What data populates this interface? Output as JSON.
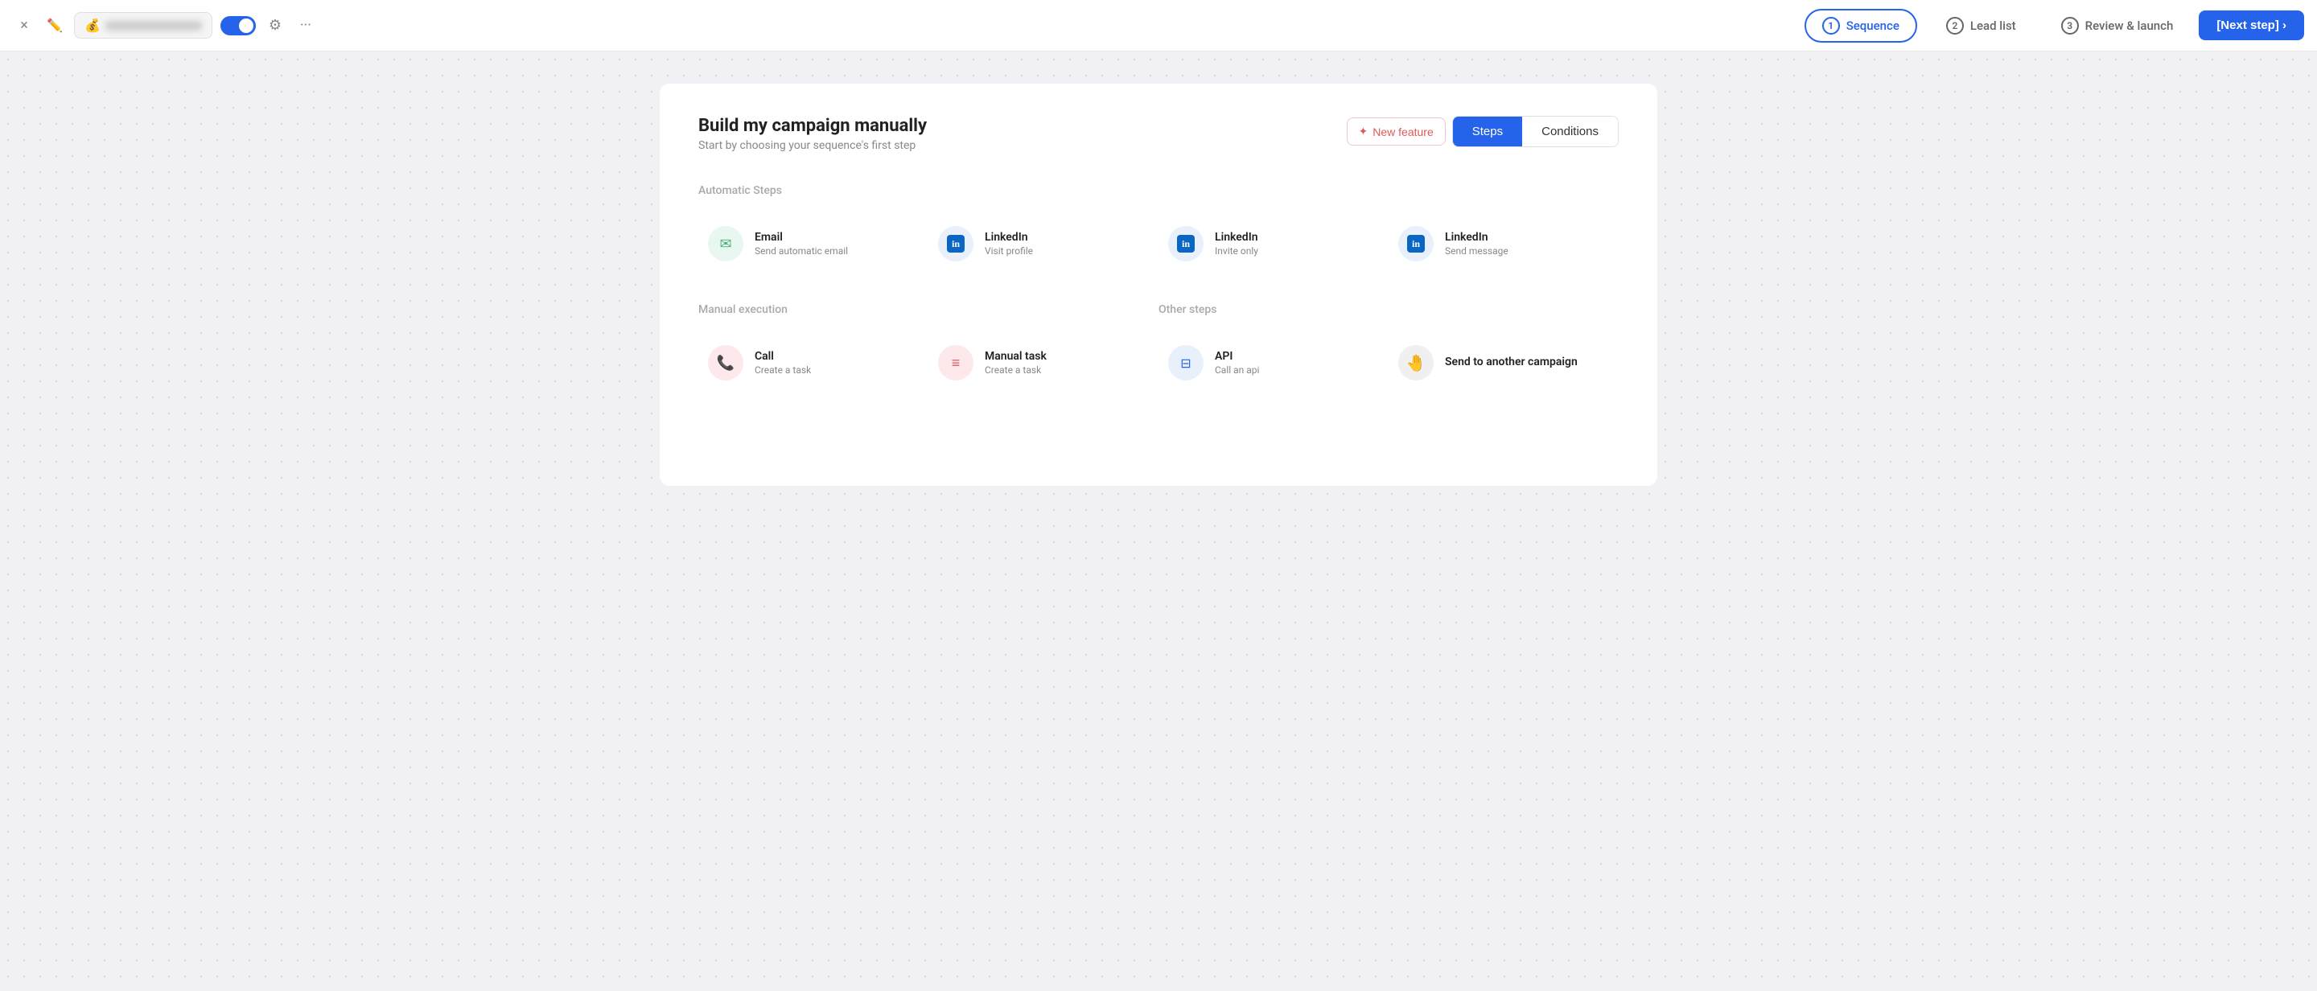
{
  "topbar": {
    "close_label": "×",
    "emoji": "💰",
    "toggle_on": true,
    "dots": "···",
    "nav": [
      {
        "num": "1",
        "label": "Sequence",
        "active": true
      },
      {
        "num": "2",
        "label": "Lead list",
        "active": false
      },
      {
        "num": "3",
        "label": "Review & launch",
        "active": false
      }
    ],
    "next_btn": "[Next step] ›"
  },
  "card": {
    "title": "Build my campaign manually",
    "subtitle": "Start by choosing your sequence's first step",
    "new_feature_label": "New feature",
    "tabs": [
      {
        "label": "Steps",
        "active": true
      },
      {
        "label": "Conditions",
        "active": false
      }
    ],
    "automatic_steps_label": "Automatic Steps",
    "automatic_steps": [
      {
        "icon_type": "email",
        "title": "Email",
        "subtitle": "Send automatic email"
      },
      {
        "icon_type": "linkedin",
        "title": "LinkedIn",
        "subtitle": "Visit profile"
      },
      {
        "icon_type": "linkedin",
        "title": "LinkedIn",
        "subtitle": "Invite only"
      },
      {
        "icon_type": "linkedin",
        "title": "LinkedIn",
        "subtitle": "Send message"
      }
    ],
    "manual_execution_label": "Manual execution",
    "manual_steps": [
      {
        "icon_type": "call",
        "title": "Call",
        "subtitle": "Create a task"
      },
      {
        "icon_type": "task",
        "title": "Manual task",
        "subtitle": "Create a task"
      }
    ],
    "other_steps_label": "Other steps",
    "other_steps": [
      {
        "icon_type": "api",
        "title": "API",
        "subtitle": "Call an api"
      },
      {
        "icon_type": "hand",
        "title": "Send to another campaign",
        "subtitle": ""
      }
    ]
  }
}
